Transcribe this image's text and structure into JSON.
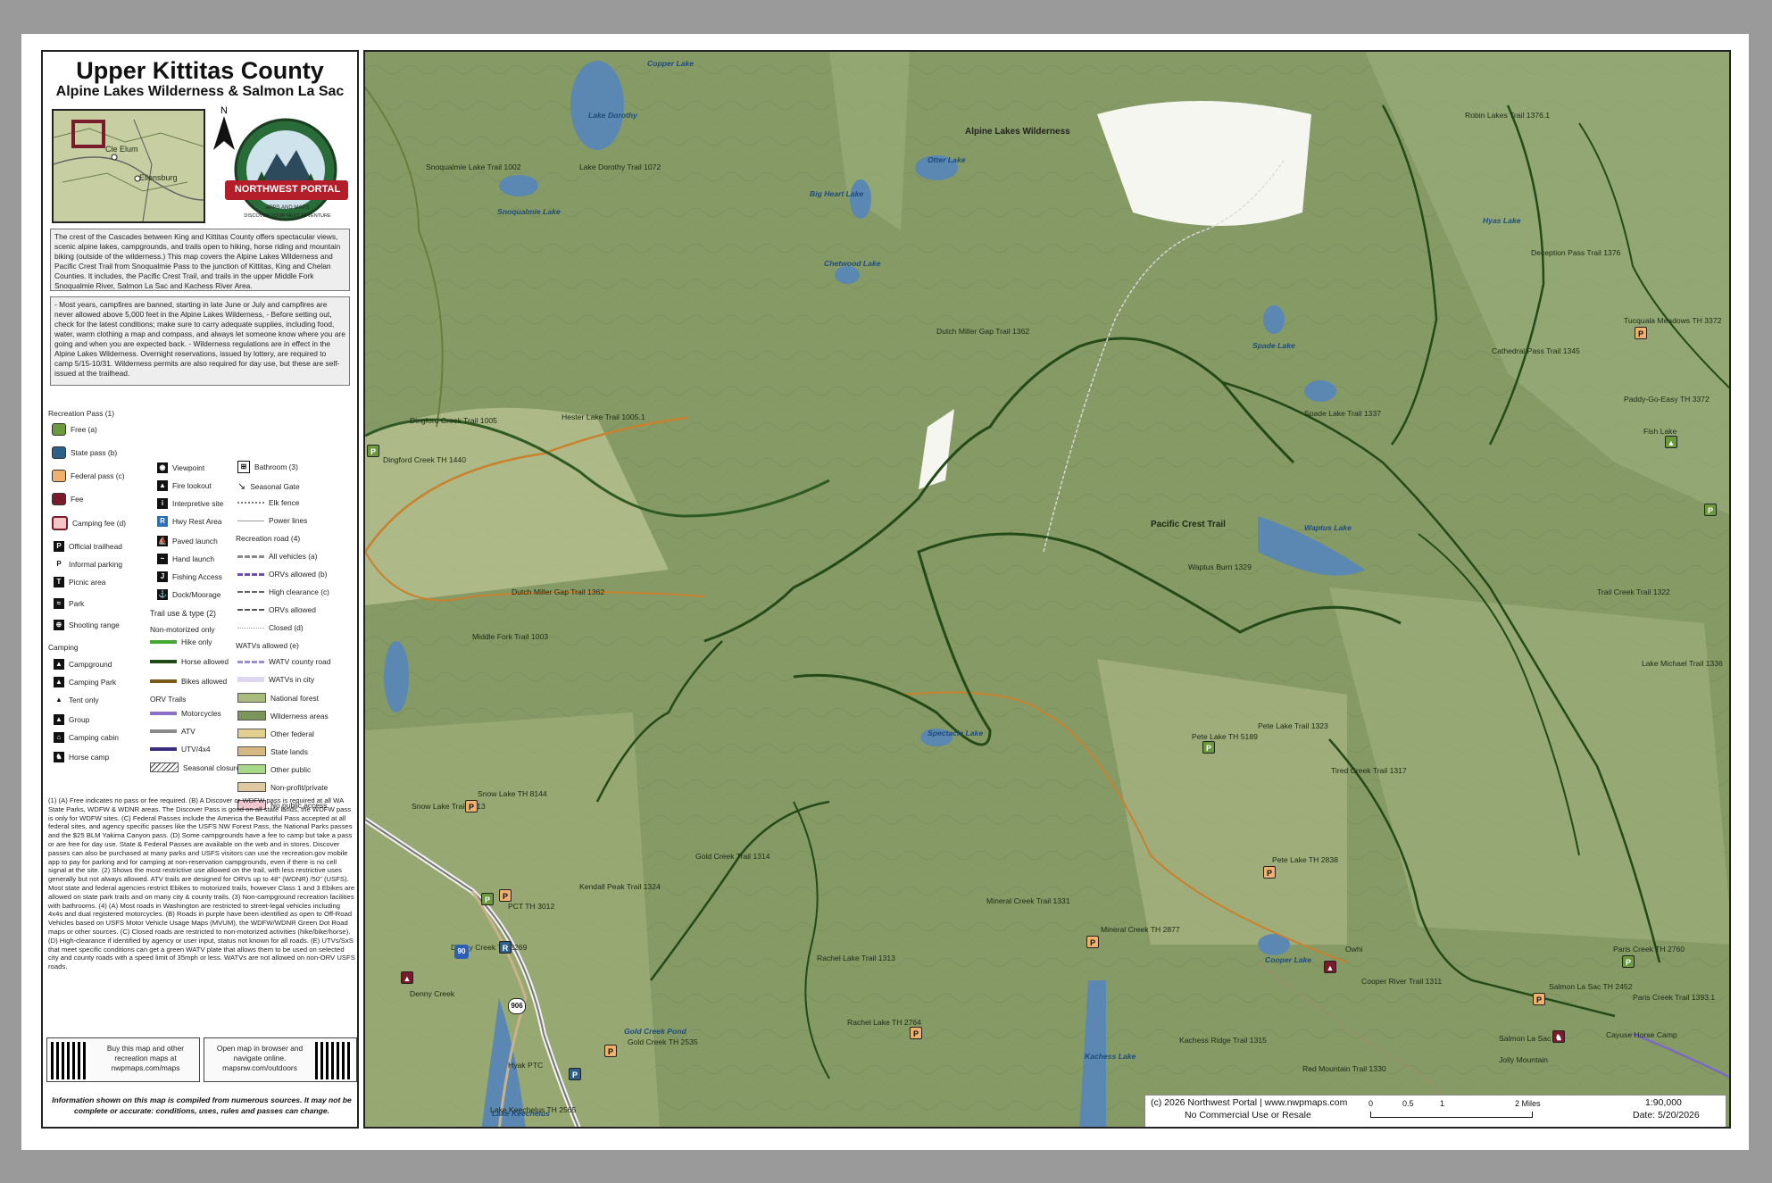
{
  "panel": {
    "title": "Upper Kittitas County",
    "subtitle": "Alpine Lakes Wilderness & Salmon La Sac",
    "north": "N",
    "inset_labels": [
      "Cle Elum",
      "Ellensburg"
    ],
    "logo": {
      "name": "NORTHWEST PORTAL",
      "sub": "APPS AND MAPS",
      "ring": "DISCOVER YOUR NEXT ADVENTURE"
    },
    "intro": "The crest of the Cascades between King and Kittitas County offers spectacular views, scenic alpine lakes, campgrounds, and trails open to hiking, horse riding and mountain biking (outside of the wilderness.) This map covers the Alpine Lakes Wilderness and Pacific Crest Trail from Snoqualmie Pass to the junction of Kittitas, King and Chelan Counties. It includes, the Pacific Crest Trail, and trails in the upper Middle Fork Snoqualmie River, Salmon La Sac and Kachess River Area.",
    "tips": "- Most years, campfires are banned, starting in late June or July and campfires are never allowed above 5,000 feet in the Alpine Lakes Wilderness, - Before setting out, check for the latest conditions; make sure to carry adequate supplies, including food, water, warm clothing a map and compass, and always let someone know where you are going and when you are expected back. - Wilderness regulations are in effect in the Alpine Lakes Wilderness. Overnight reservations, issued by lottery, are required to camp 5/15-10/31. Wilderness permits are also required for day use, but these are self-issued at the trailhead.",
    "legend": {
      "rec_pass_header": "Recreation Pass (1)",
      "passes": [
        {
          "label": "Free (a)",
          "color": "#6a9a3c"
        },
        {
          "label": "State pass (b)",
          "color": "#2d5f8a"
        },
        {
          "label": "Federal pass (c)",
          "color": "#f1b16c"
        },
        {
          "label": "Fee",
          "color": "#7a1b2c"
        },
        {
          "label": "Camping fee (d)",
          "color": "#f3c6c8"
        }
      ],
      "facilities": [
        "Official trailhead",
        "Informal parking",
        "Picnic area",
        "Park",
        "Shooting range"
      ],
      "facility_icons": [
        "P",
        "P",
        "T",
        "≈",
        "⊕"
      ],
      "camping_header": "Camping",
      "camping": [
        "Campground",
        "Camping Park",
        "Tent only",
        "Group",
        "Camping cabin",
        "Horse camp"
      ],
      "col2": [
        "Viewpoint",
        "Fire lookout",
        "Interpretive site",
        "Hwy Rest Area",
        "Paved launch",
        "Hand launch",
        "Fishing Access",
        "Dock/Moorage"
      ],
      "trail_header": "Trail use & type (2)",
      "nonmotor_header": "Non-motorized only",
      "trails": [
        {
          "label": "Hike only",
          "color": "#43a832"
        },
        {
          "label": "Horse allowed",
          "color": "#1f4a16"
        },
        {
          "label": "Bikes allowed",
          "color": "#7a5a18"
        }
      ],
      "orv_header": "ORV Trails",
      "orv": [
        {
          "label": "Motorcycles",
          "color": "#8b6fc9"
        },
        {
          "label": "ATV",
          "color": "#8a8a8a"
        },
        {
          "label": "UTV/4x4",
          "color": "#3b2e7e"
        }
      ],
      "seasonal": "Seasonal closure",
      "col3": [
        "Bathroom (3)",
        "Seasonal Gate",
        "Elk fence",
        "Power lines"
      ],
      "road_header": "Recreation road (4)",
      "roads": [
        {
          "label": "All vehicles (a)",
          "color": "#8a8a8a"
        },
        {
          "label": "ORVs allowed (b)",
          "color": "#6c4fb0"
        },
        {
          "label": "High clearance (c)",
          "color": "#666"
        },
        {
          "label": "ORVs allowed",
          "color": "#555"
        },
        {
          "label": "Closed (d)",
          "color": "#999"
        }
      ],
      "watv_header": "WATVs allowed (e)",
      "watv": [
        "WATV county road",
        "WATVs in city"
      ],
      "lands": [
        {
          "label": "National forest",
          "color": "#a9bb7d"
        },
        {
          "label": "Wilderness areas",
          "color": "#7b955a"
        },
        {
          "label": "Other federal",
          "color": "#e2ce8f"
        },
        {
          "label": "State lands",
          "color": "#d6b882"
        },
        {
          "label": "Other public",
          "color": "#a7d989"
        },
        {
          "label": "Non-profit/private",
          "color": "#e0c8a0"
        },
        {
          "label": "No public access",
          "color": "#f2c7d0"
        }
      ]
    },
    "notes": "(1) (A) Free indicates no pass or fee required. (B) A Discover or WDFW pass is required at all WA State Parks, WDFW & WDNR areas. The Discover Pass is good on all state lands, the WDFW pass is only for WDFW sites. (C) Federal Passes include the America the Beautiful Pass accepted at all federal sites, and agency specific passes like the USFS NW Forest Pass, the National Parks passes and the $25 BLM Yakima Canyon pass. (D) Some campgrounds have a fee to camp but take a pass or are free for day use. State & Federal Passes are available on the web and in stores. Discover passes can also be purchased at many parks and USFS visitors can use the recreation.gov mobile app to pay for parking and for camping at non-reservation campgrounds, even if there is no cell signal at the site. (2) Shows the most restrictive use allowed on the trail, with less restrictive uses generally but not always allowed. ATV trails are designed for ORVs up to 48\" (WDNR) /50\" (USFS). Most state and federal agencies restrict Ebikes to motorized trails, however Class 1 and 3 Ebikes are allowed on state park trails and on many city & county trails. (3) Non-campground recreation facilities with bathrooms. (4) (A) Most roads in Washington are restricted to street-legal vehicles including 4x4s and dual registered motorcycles. (B) Roads in purple have been identified as open to Off-Road Vehicles based on USFS Motor Vehicle Usage Maps (MVUM), the WDFW/WDNR Green Dot Road maps or other sources. (C) Closed roads are restricted to non-motorized activities (hike/bike/horse). (D) High-clearance if identified by agency or user input, status not known for all roads. (E) UTVs/SxS that meet specific conditions can get a green WATV plate that allows them to be used on selected city and county roads with a speed limit of 35mph or less. WATVs are not allowed on non-ORV USFS roads.",
    "qr_buy": "Buy this map and other recreation maps at nwpmaps.com/maps",
    "qr_open": "Open map in browser and navigate online. mapsnw.com/outdoors",
    "disclaimer": "Information shown on this map is compiled from numerous sources. It may not be complete or accurate: conditions, uses, rules and passes can change."
  },
  "map": {
    "water_labels": [
      "Copper Lake",
      "Lake Dorothy",
      "Snoqualmie Lake",
      "Big Heart Lake",
      "Chetwood Lake",
      "Otter Lake",
      "Spade Lake",
      "Waptus Lake",
      "Spectacle Lake",
      "Cooper Lake",
      "Kachess Lake",
      "Lake Keechelus",
      "Gold Creek Pond",
      "Hyas Lake"
    ],
    "place_labels": [
      "Alpine Lakes Wilderness",
      "Pacific Crest Trail",
      "Snoqualmie Lake Trail 1002",
      "Lake Dorothy Trail 1072",
      "Dingford Creek Trail 1005",
      "Hester Lake Trail 1005.1",
      "Dutch Miller Gap Trail 1362",
      "Dutch Miller Gap Trail 1362",
      "Middle Fork Trail 1003",
      "Robin Lakes Trail 1376.1",
      "Deception Pass Trail 1376",
      "Cathedral Pass Trail 1345",
      "Spade Lake Trail 1337",
      "Waptus Burn 1329",
      "Trail Creek Trail 1322",
      "Lake Michael Trail 1336",
      "Pete Lake Trail 1323",
      "Tired Creek Trail 1317",
      "Mineral Creek Trail 1331",
      "Rachel Lake Trail 1313",
      "Gold Creek Trail 1314",
      "Kendall Peak Trail 1324",
      "Snow Lake Trail 1013",
      "Cooper River Trail 1311",
      "Paris Creek Trail 1393.1",
      "Red Mountain Trail 1330",
      "Kachess Ridge Trail 1315",
      "Owhi",
      "Cayuse Horse Camp",
      "Jolly Mountain",
      "Salmon La Sac",
      "Fish Lake",
      "Paddy-Go-Easy TH 3372",
      "Tucquala Meadows TH 3372",
      "Dingford Creek TH 1440",
      "Snow Lake TH 8144",
      "Pete Lake TH 5189",
      "Pete Lake TH 2838",
      "Mineral Creek TH 2877",
      "Rachel Lake TH 2764",
      "Gold Creek TH 2535",
      "Salmon La Sac TH 2452",
      "Paris Creek TH 2760",
      "Denny Creek",
      "PCT TH 3012",
      "Denny Creek TH 2269",
      "Hyak PTC",
      "Lake Keechelus TH 2565"
    ],
    "road_shields": [
      "90",
      "906"
    ],
    "footer": {
      "copyright": "(c) 2026 Northwest Portal | www.nwpmaps.com",
      "usage": "No Commercial Use or Resale",
      "scale_ticks": [
        "0",
        "0.5",
        "1",
        "2 Miles"
      ],
      "ratio": "1:90,000",
      "date": "Date: 5/20/2026"
    }
  }
}
